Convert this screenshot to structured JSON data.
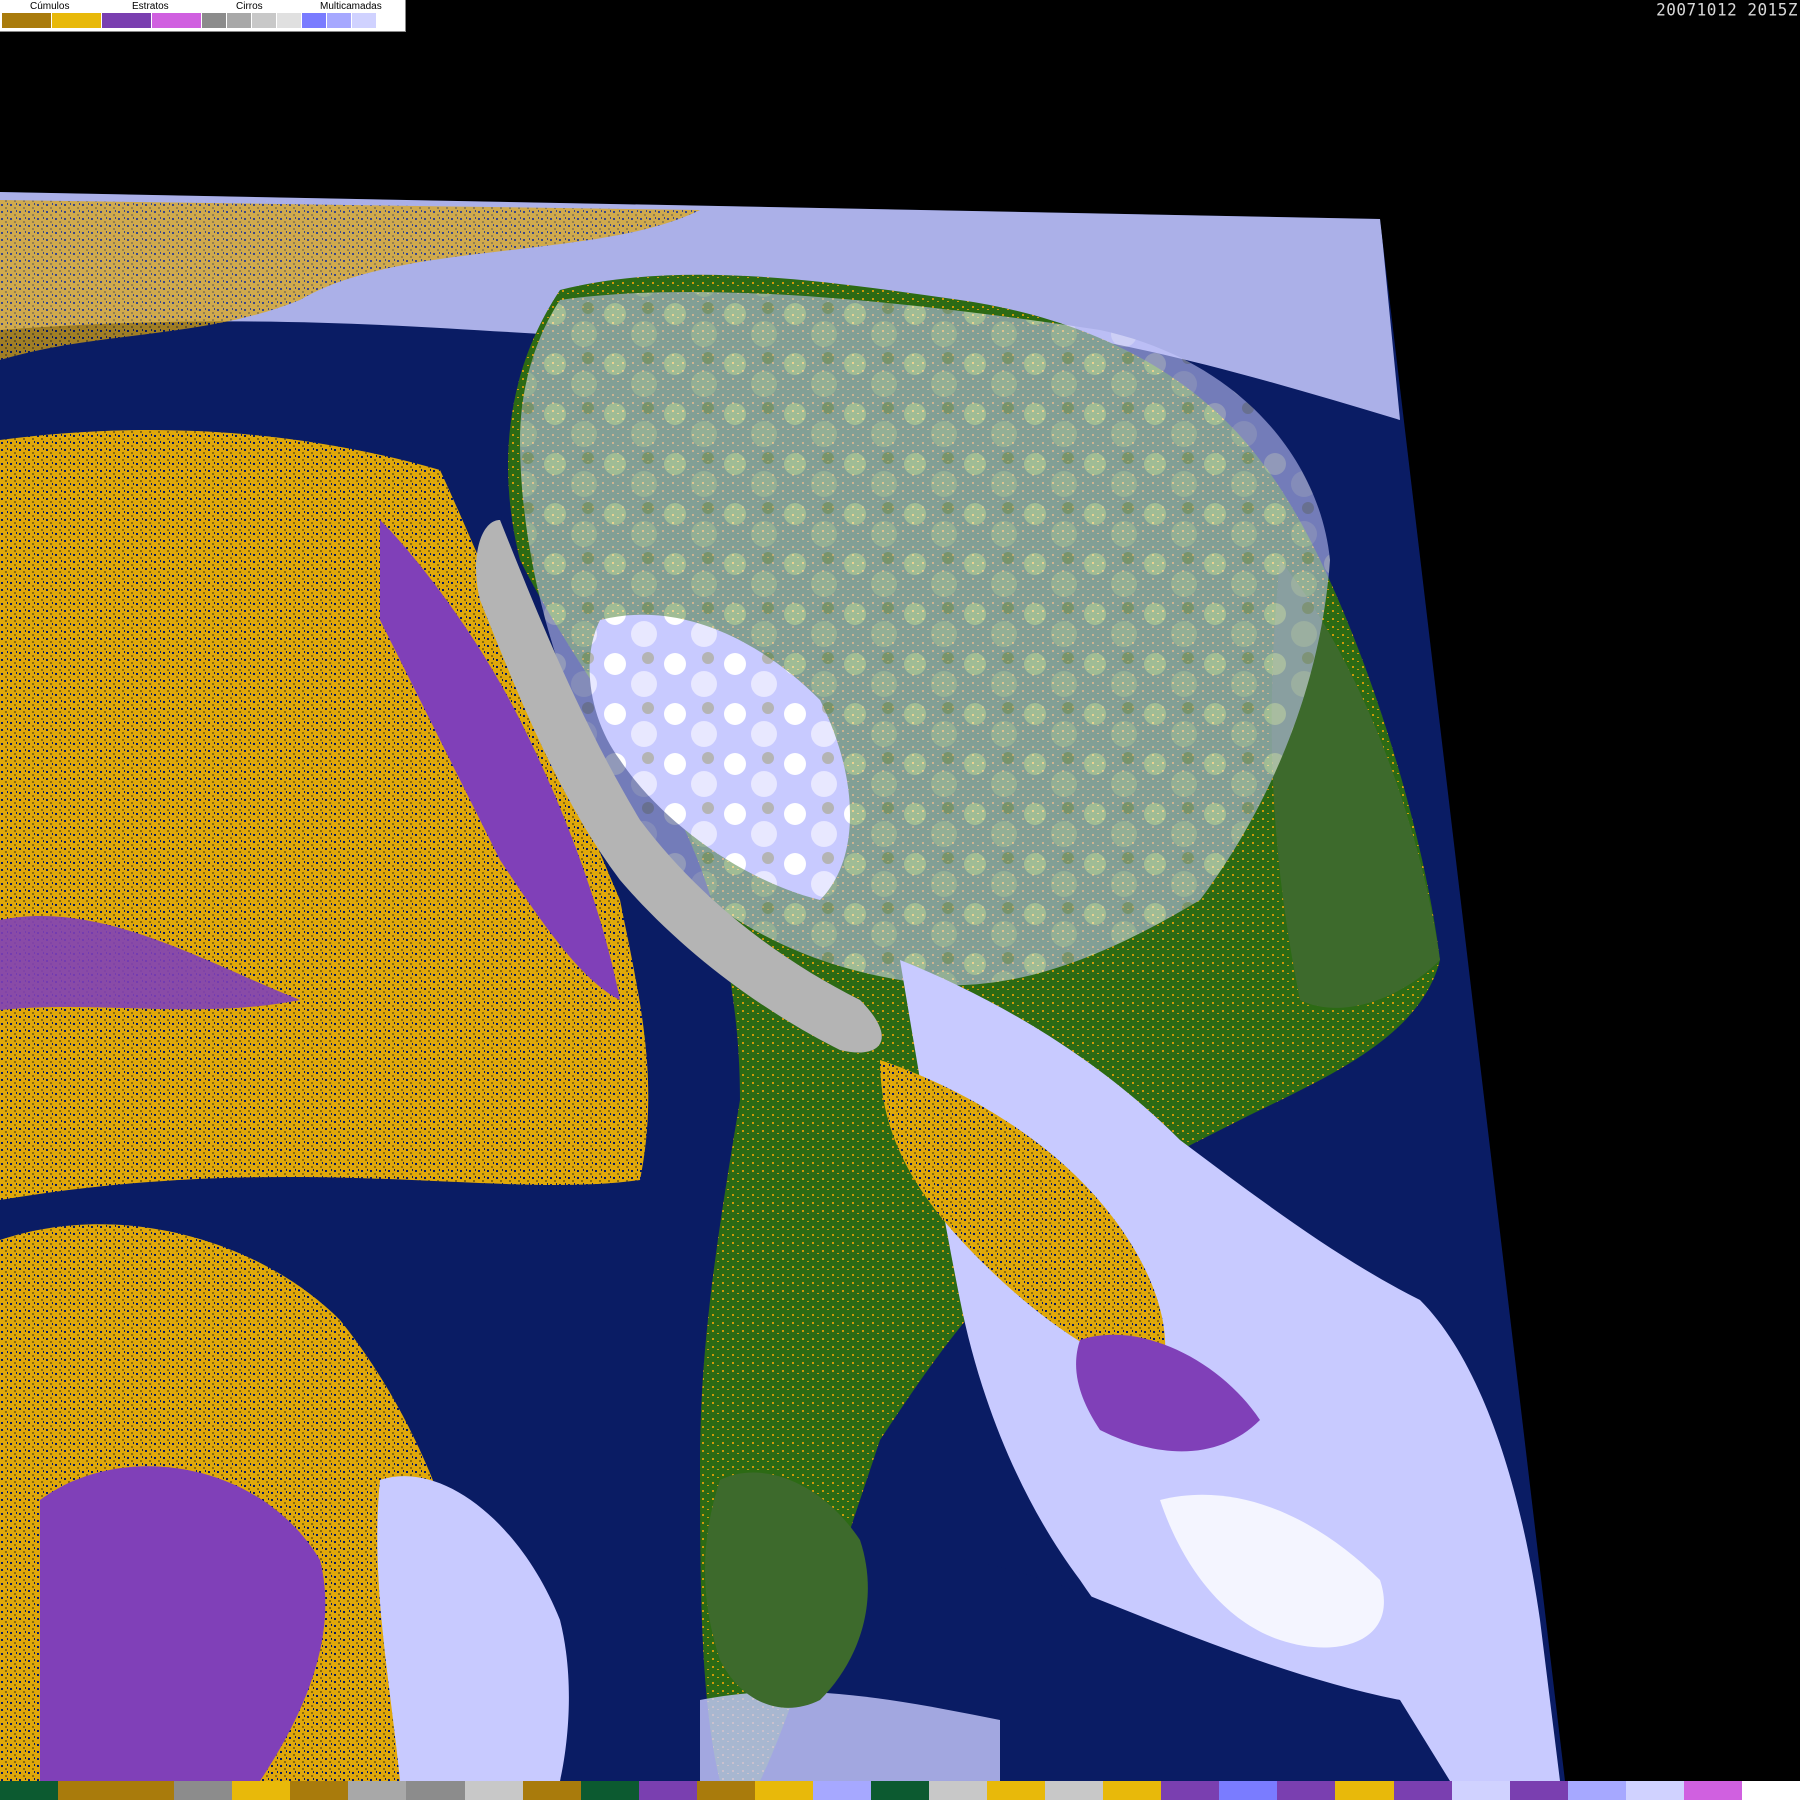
{
  "legend": {
    "categories": [
      {
        "label": "Cúmulos",
        "colors": [
          "#a97b0c",
          "#e8b90a"
        ]
      },
      {
        "label": "Estratos",
        "colors": [
          "#7a3fb0",
          "#d060e0"
        ]
      },
      {
        "label": "Cirros",
        "colors": [
          "#8c8c8c",
          "#a8a8a8",
          "#c8c8c8",
          "#e0e0e0"
        ]
      },
      {
        "label": "Multicamadas",
        "colors": [
          "#7a7cff",
          "#a6a8ff",
          "#d0d2ff",
          "#ffffff"
        ]
      }
    ]
  },
  "timestamp": "20071012 2015Z",
  "colors": {
    "ocean": "#0a1c64",
    "land_green": "#2f6e1a",
    "land_forest": "#3d6a2c",
    "cumulus": "#e0a80a",
    "stratus": "#8040b8",
    "cirrus": "#b4b4b4",
    "multilayer": "#c8caff",
    "background": "#000000"
  },
  "bottom_strip": [
    "#0c5a30",
    "#a97b0c",
    "#a97b0c",
    "#8c8c8c",
    "#e8b90a",
    "#a97b0c",
    "#a8a8a8",
    "#8c8c8c",
    "#c8c8c8",
    "#a97b0c",
    "#0c5a30",
    "#7a3fb0",
    "#a97b0c",
    "#e8b90a",
    "#a6a8ff",
    "#0c5a30",
    "#c8c8c8",
    "#e8b90a",
    "#c8c8c8",
    "#e8b90a",
    "#7a3fb0",
    "#7a7cff",
    "#7a3fb0",
    "#e8b90a",
    "#7a3fb0",
    "#d0d2ff",
    "#7a3fb0",
    "#a6a8ff",
    "#d0d2ff",
    "#d060e0",
    "#ffffff"
  ]
}
